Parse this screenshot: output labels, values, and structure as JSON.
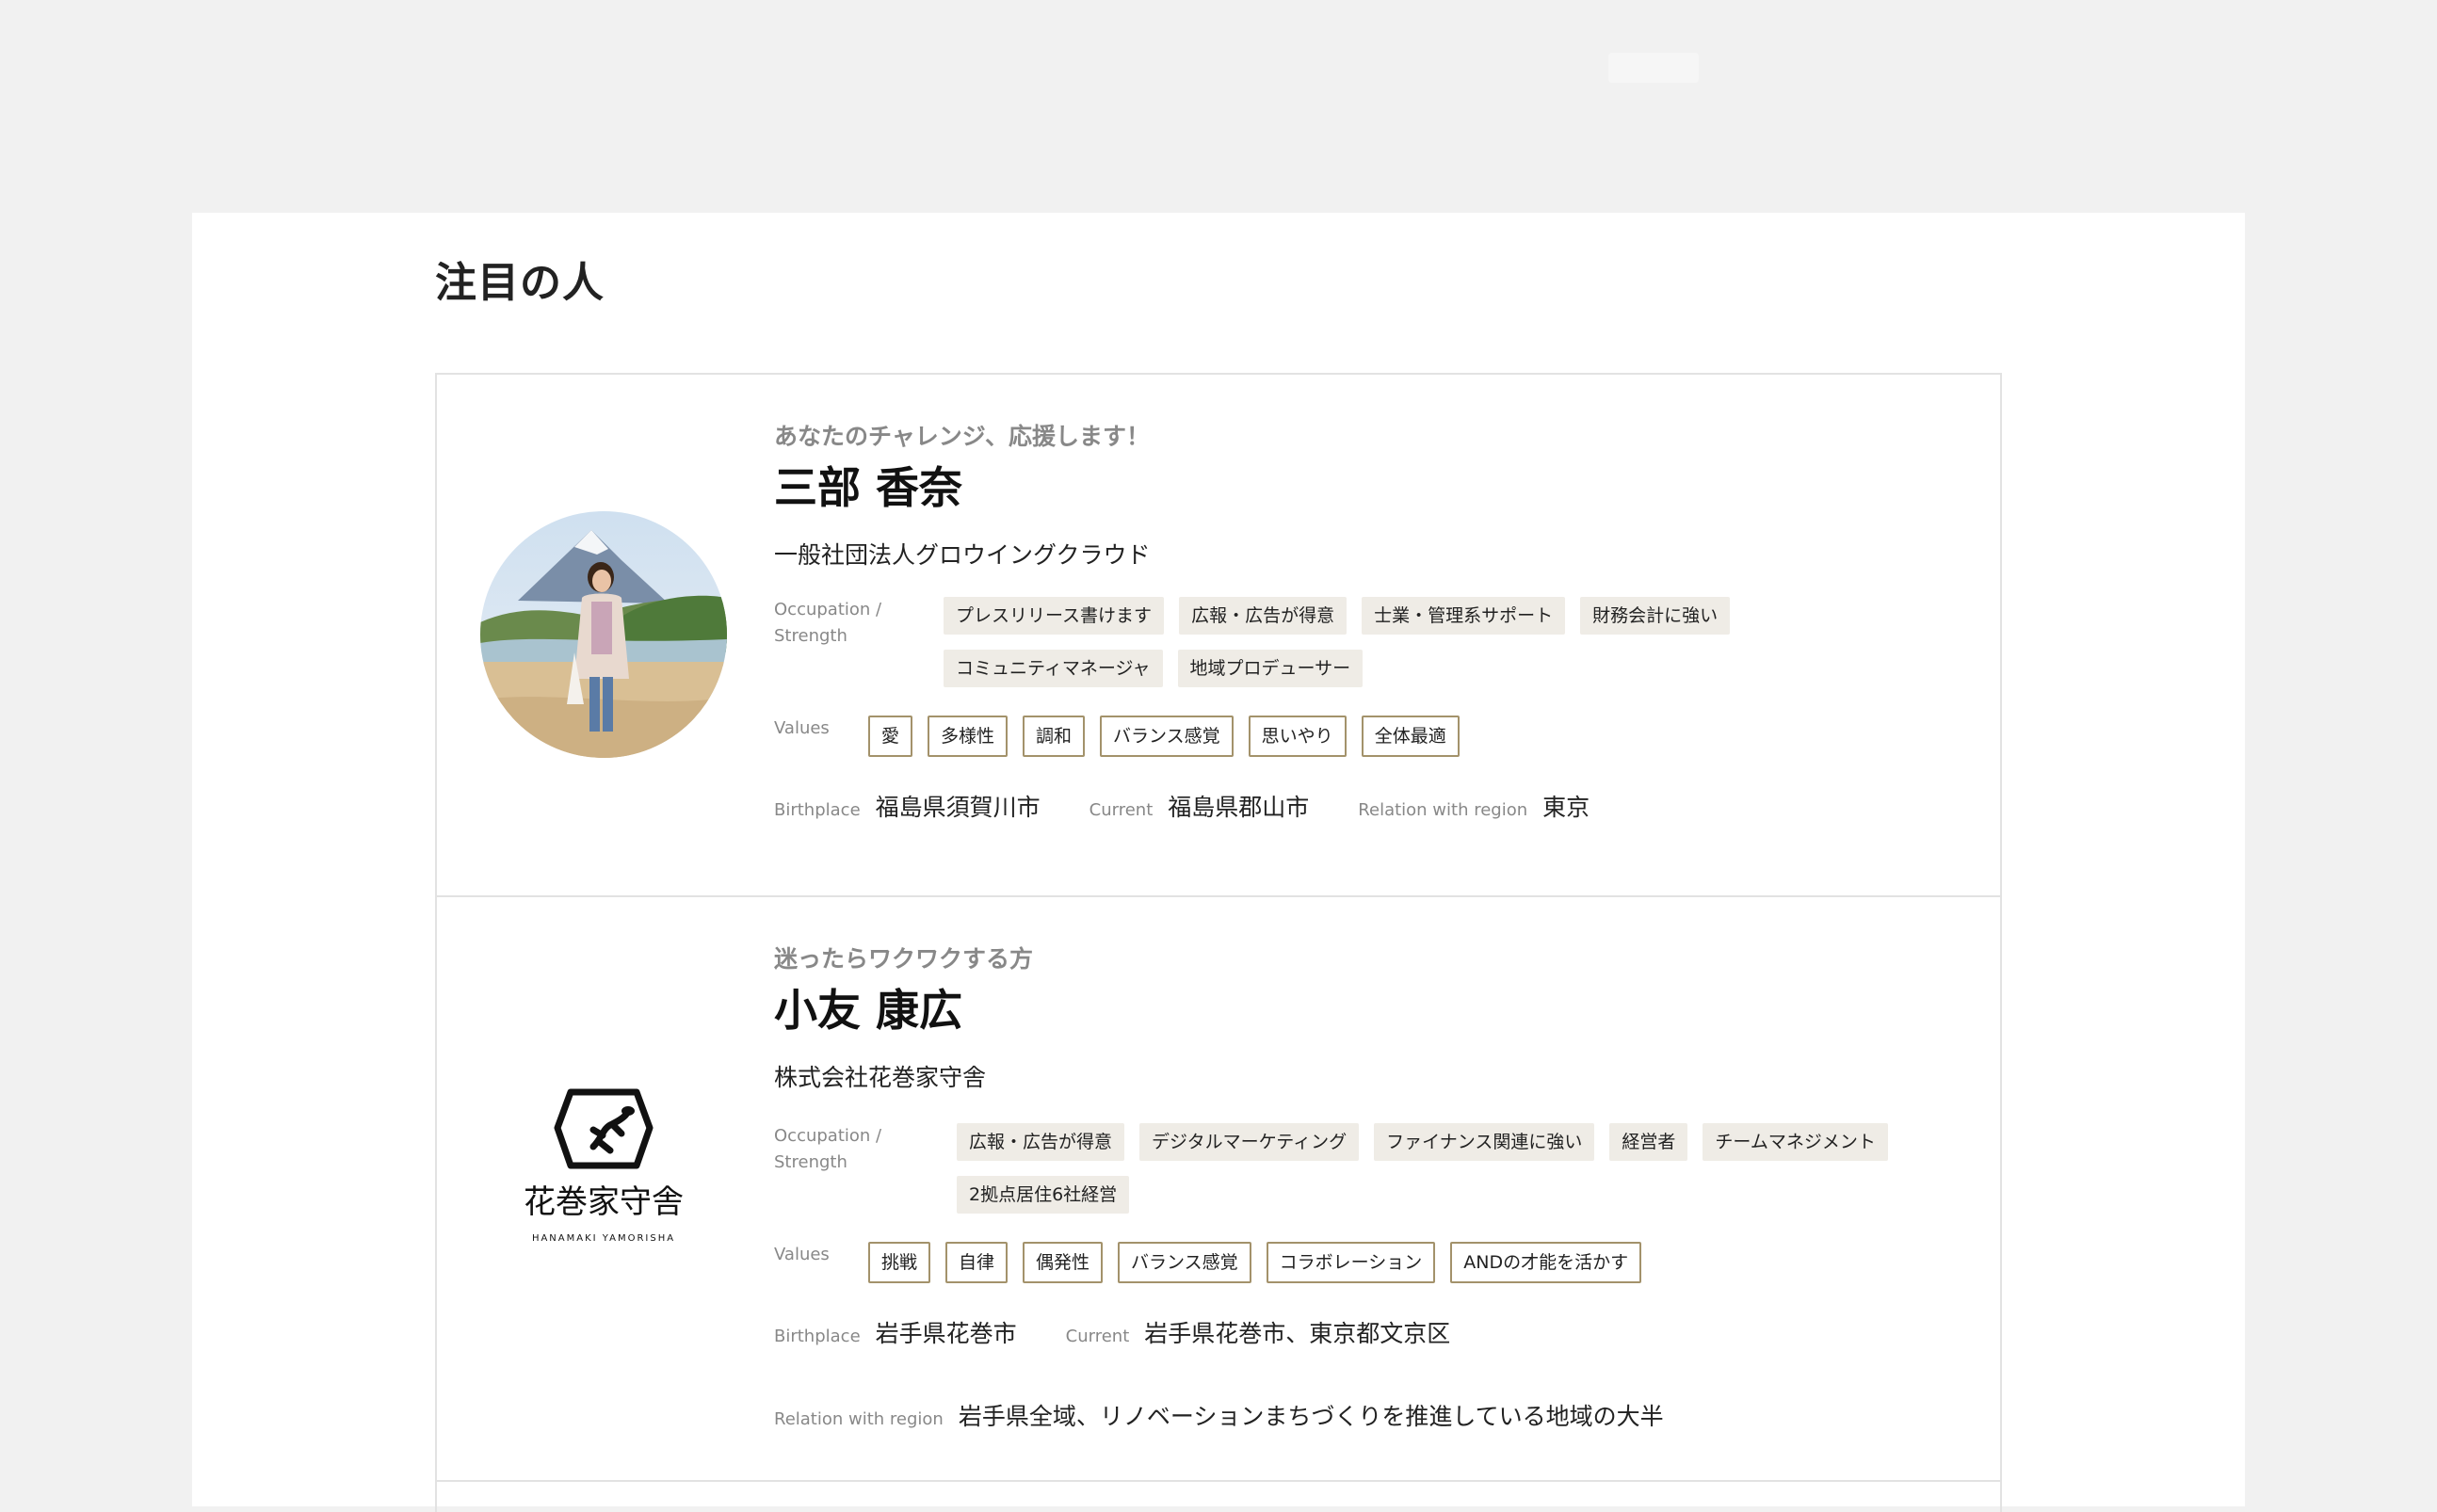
{
  "section_title": "注目の人",
  "labels": {
    "occupation": "Occupation / Strength",
    "values": "Values",
    "birthplace": "Birthplace",
    "current": "Current",
    "relation": "Relation with region"
  },
  "people": [
    {
      "catch": "あなたのチャレンジ、応援します！",
      "name": "三部 香奈",
      "org": "一般社団法人グロウイングクラウド",
      "occupation": [
        "プレスリリース書けます",
        "広報・広告が得意",
        "士業・管理系サポート",
        "財務会計に強い",
        "コミュニティマネージャ",
        "地域プロデューサー"
      ],
      "values": [
        "愛",
        "多様性",
        "調和",
        "バランス感覚",
        "思いやり",
        "全体最適"
      ],
      "birthplace": "福島県須賀川市",
      "current": "福島県郡山市",
      "relation": "東京"
    },
    {
      "catch": "迷ったらワクワクする方",
      "name": "小友 康広",
      "org": "株式会社花巻家守舎",
      "occupation": [
        "広報・広告が得意",
        "デジタルマーケティング",
        "ファイナンス関連に強い",
        "経営者",
        "チームマネジメント",
        "2拠点居住6社経営"
      ],
      "values": [
        "挑戦",
        "自律",
        "偶発性",
        "バランス感覚",
        "コラボレーション",
        "ANDの才能を活かす"
      ],
      "birthplace": "岩手県花巻市",
      "current": "岩手県花巻市、東京都文京区",
      "relation": "岩手県全域、リノベーションまちづくりを推進している地域の大半",
      "logo_text": "花巻家守舎",
      "logo_sub": "HANAMAKI YAMORISHA"
    }
  ]
}
